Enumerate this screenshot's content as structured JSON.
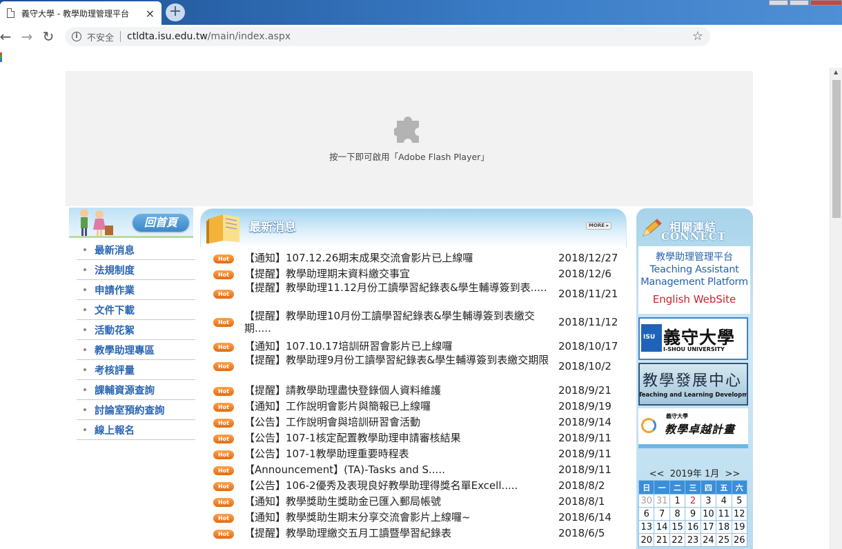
{
  "browser": {
    "tab_title": "義守大學 - 教學助理管理平台",
    "tab_close": "×",
    "new_tab": "+",
    "address": {
      "security_label": "不安全",
      "host": "ctldta.isu.edu.tw",
      "path": "/main/index.aspx"
    },
    "nav": {
      "back": "←",
      "forward": "→",
      "reload": "↻",
      "bookmark_star": "☆"
    }
  },
  "flash": {
    "message": "按一下即可啟用「Adobe Flash Player」"
  },
  "left_menu": {
    "home_label": "回首頁",
    "items": [
      {
        "label": "最新消息"
      },
      {
        "label": "法規制度"
      },
      {
        "label": "申請作業"
      },
      {
        "label": "文件下載"
      },
      {
        "label": "活動花絮"
      },
      {
        "label": "教學助理專區"
      },
      {
        "label": "考核評量"
      },
      {
        "label": "課輔資源查詢"
      },
      {
        "label": "討論室預約查詢"
      },
      {
        "label": "線上報名"
      }
    ]
  },
  "news": {
    "title": "最新消息",
    "more_label": "MORE",
    "hot_label": "Hot",
    "items": [
      {
        "title": "【通知】107.12.26期末成果交流會影片已上線囉",
        "date": "2018/12/27"
      },
      {
        "title": "【提醒】教學助理期末資料繳交事宜",
        "date": "2018/12/6"
      },
      {
        "title": "【提醒】教學助理11.12月份工讀學習紀錄表&學生輔導簽到表.....",
        "date": "2018/11/21"
      },
      {
        "title": "【提醒】教學助理10月份工讀學習紀錄表&學生輔導簽到表繳交期.....",
        "date": "2018/11/12"
      },
      {
        "title": "【通知】107.10.17培訓研習會影片已上線囉",
        "date": "2018/10/17"
      },
      {
        "title": "【提醒】教學助理9月份工讀學習紀錄表&學生輔導簽到表繳交期限",
        "date": "2018/10/2"
      },
      {
        "title": "【提醒】請教學助理盡快登錄個人資料維護",
        "date": "2018/9/21"
      },
      {
        "title": "【通知】工作說明會影片與簡報已上線囉",
        "date": "2018/9/19"
      },
      {
        "title": "【公告】工作說明會與培訓研習會活動",
        "date": "2018/9/14"
      },
      {
        "title": "【公告】107-1核定配置教學助理申請審核結果",
        "date": "2018/9/11"
      },
      {
        "title": "【公告】107-1教學助理重要時程表",
        "date": "2018/9/11"
      },
      {
        "title": "【Announcement】(TA)-Tasks and S.....",
        "date": "2018/9/11"
      },
      {
        "title": "【公告】106-2優秀及表現良好教學助理得獎名單Excell.....",
        "date": "2018/8/2"
      },
      {
        "title": "【通知】教學獎助生獎助金已匯入郵局帳號",
        "date": "2018/8/1"
      },
      {
        "title": "【通知】教學獎助生期末分享交流會影片上線囉~",
        "date": "2018/6/14"
      },
      {
        "title": "【提醒】教學助理繳交五月工讀暨學習紀錄表",
        "date": "2018/6/5"
      }
    ]
  },
  "related": {
    "title_zh": "相關連結",
    "title_en": "CONNECT",
    "ta_platform": {
      "line1": "教學助理管理平台",
      "line2": "Teaching Assistant",
      "line3": "Management Platform",
      "english_site": "English WebSite"
    },
    "isu": {
      "zh": "義守大學",
      "en": "I-SHOU UNIVERSITY",
      "mark": "ISU"
    },
    "ctld": {
      "zh": "教學發展中心",
      "en": "Teaching and Learning Development"
    },
    "excellence": {
      "small": "義守大學",
      "big": "教學卓越計畫"
    }
  },
  "calendar": {
    "prev": "<<",
    "next": ">>",
    "month_label": "2019年 1月",
    "weekdays": [
      "日",
      "一",
      "二",
      "三",
      "四",
      "五",
      "六"
    ],
    "weeks": [
      [
        "30",
        "31",
        "1",
        "2",
        "3",
        "4",
        "5"
      ],
      [
        "6",
        "7",
        "8",
        "9",
        "10",
        "11",
        "12"
      ],
      [
        "13",
        "14",
        "15",
        "16",
        "17",
        "18",
        "19"
      ],
      [
        "20",
        "21",
        "22",
        "23",
        "24",
        "25",
        "26"
      ]
    ],
    "colors": {
      "header": "#3b8ed8",
      "today": "#d0202a"
    }
  }
}
